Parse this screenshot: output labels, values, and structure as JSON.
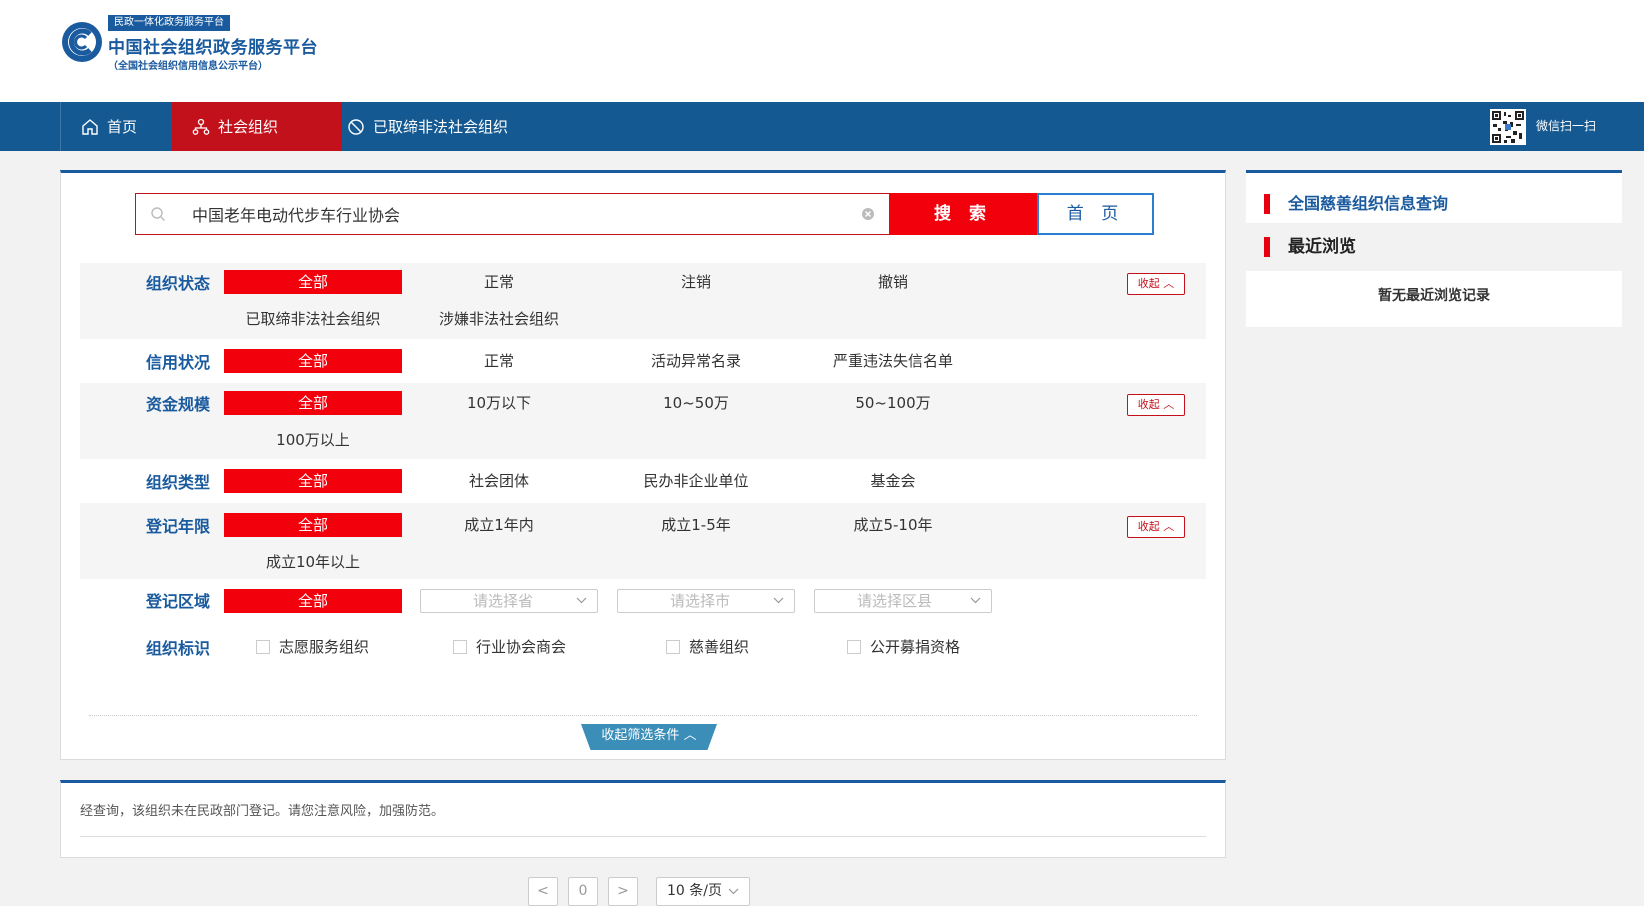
{
  "brand": {
    "tag": "民政一体化政务服务平台",
    "title": "中国社会组织政务服务平台",
    "subtitle": "（全国社会组织信用信息公示平台）",
    "colors": {
      "blue": "#1a5a9e",
      "red": "#c3111c",
      "nav": "#145992",
      "accent_red": "#f3000d"
    }
  },
  "nav": {
    "items": [
      {
        "label": "首页",
        "icon": "home-icon"
      },
      {
        "label": "社会组织",
        "icon": "org-icon",
        "active": true
      },
      {
        "label": "已取缔非法社会组织",
        "icon": "ban-icon"
      }
    ],
    "qr_label": "微信扫一扫"
  },
  "search": {
    "value": "中国老年电动代步车行业协会",
    "placeholder": "",
    "button_label": "搜 索",
    "home_label": "首 页"
  },
  "filters": {
    "org_status": {
      "label": "组织状态",
      "options": [
        "全部",
        "正常",
        "注销",
        "撤销",
        "已取缔非法社会组织",
        "涉嫌非法社会组织"
      ],
      "collapse": "收起"
    },
    "credit": {
      "label": "信用状况",
      "options": [
        "全部",
        "正常",
        "活动异常名录",
        "严重违法失信名单"
      ]
    },
    "capital": {
      "label": "资金规模",
      "options": [
        "全部",
        "10万以下",
        "10~50万",
        "50~100万",
        "100万以上"
      ],
      "collapse": "收起"
    },
    "org_type": {
      "label": "组织类型",
      "options": [
        "全部",
        "社会团体",
        "民办非企业单位",
        "基金会"
      ]
    },
    "reg_years": {
      "label": "登记年限",
      "options": [
        "全部",
        "成立1年内",
        "成立1-5年",
        "成立5-10年",
        "成立10年以上"
      ],
      "collapse": "收起"
    },
    "region": {
      "label": "登记区域",
      "all": "全部",
      "province": "请选择省",
      "city": "请选择市",
      "county": "请选择区县"
    },
    "tags": {
      "label": "组织标识",
      "options": [
        "志愿服务组织",
        "行业协会商会",
        "慈善组织",
        "公开募捐资格"
      ]
    },
    "collapse_all": "收起筛选条件"
  },
  "notice": {
    "text": "经查询，该组织未在民政部门登记。请您注意风险，加强防范。"
  },
  "pagination": {
    "prev": "<",
    "page": "0",
    "next": ">",
    "page_size": "10 条/页"
  },
  "sidebar": {
    "link": "全国慈善组织信息查询",
    "recent_title": "最近浏览",
    "empty": "暂无最近浏览记录"
  }
}
